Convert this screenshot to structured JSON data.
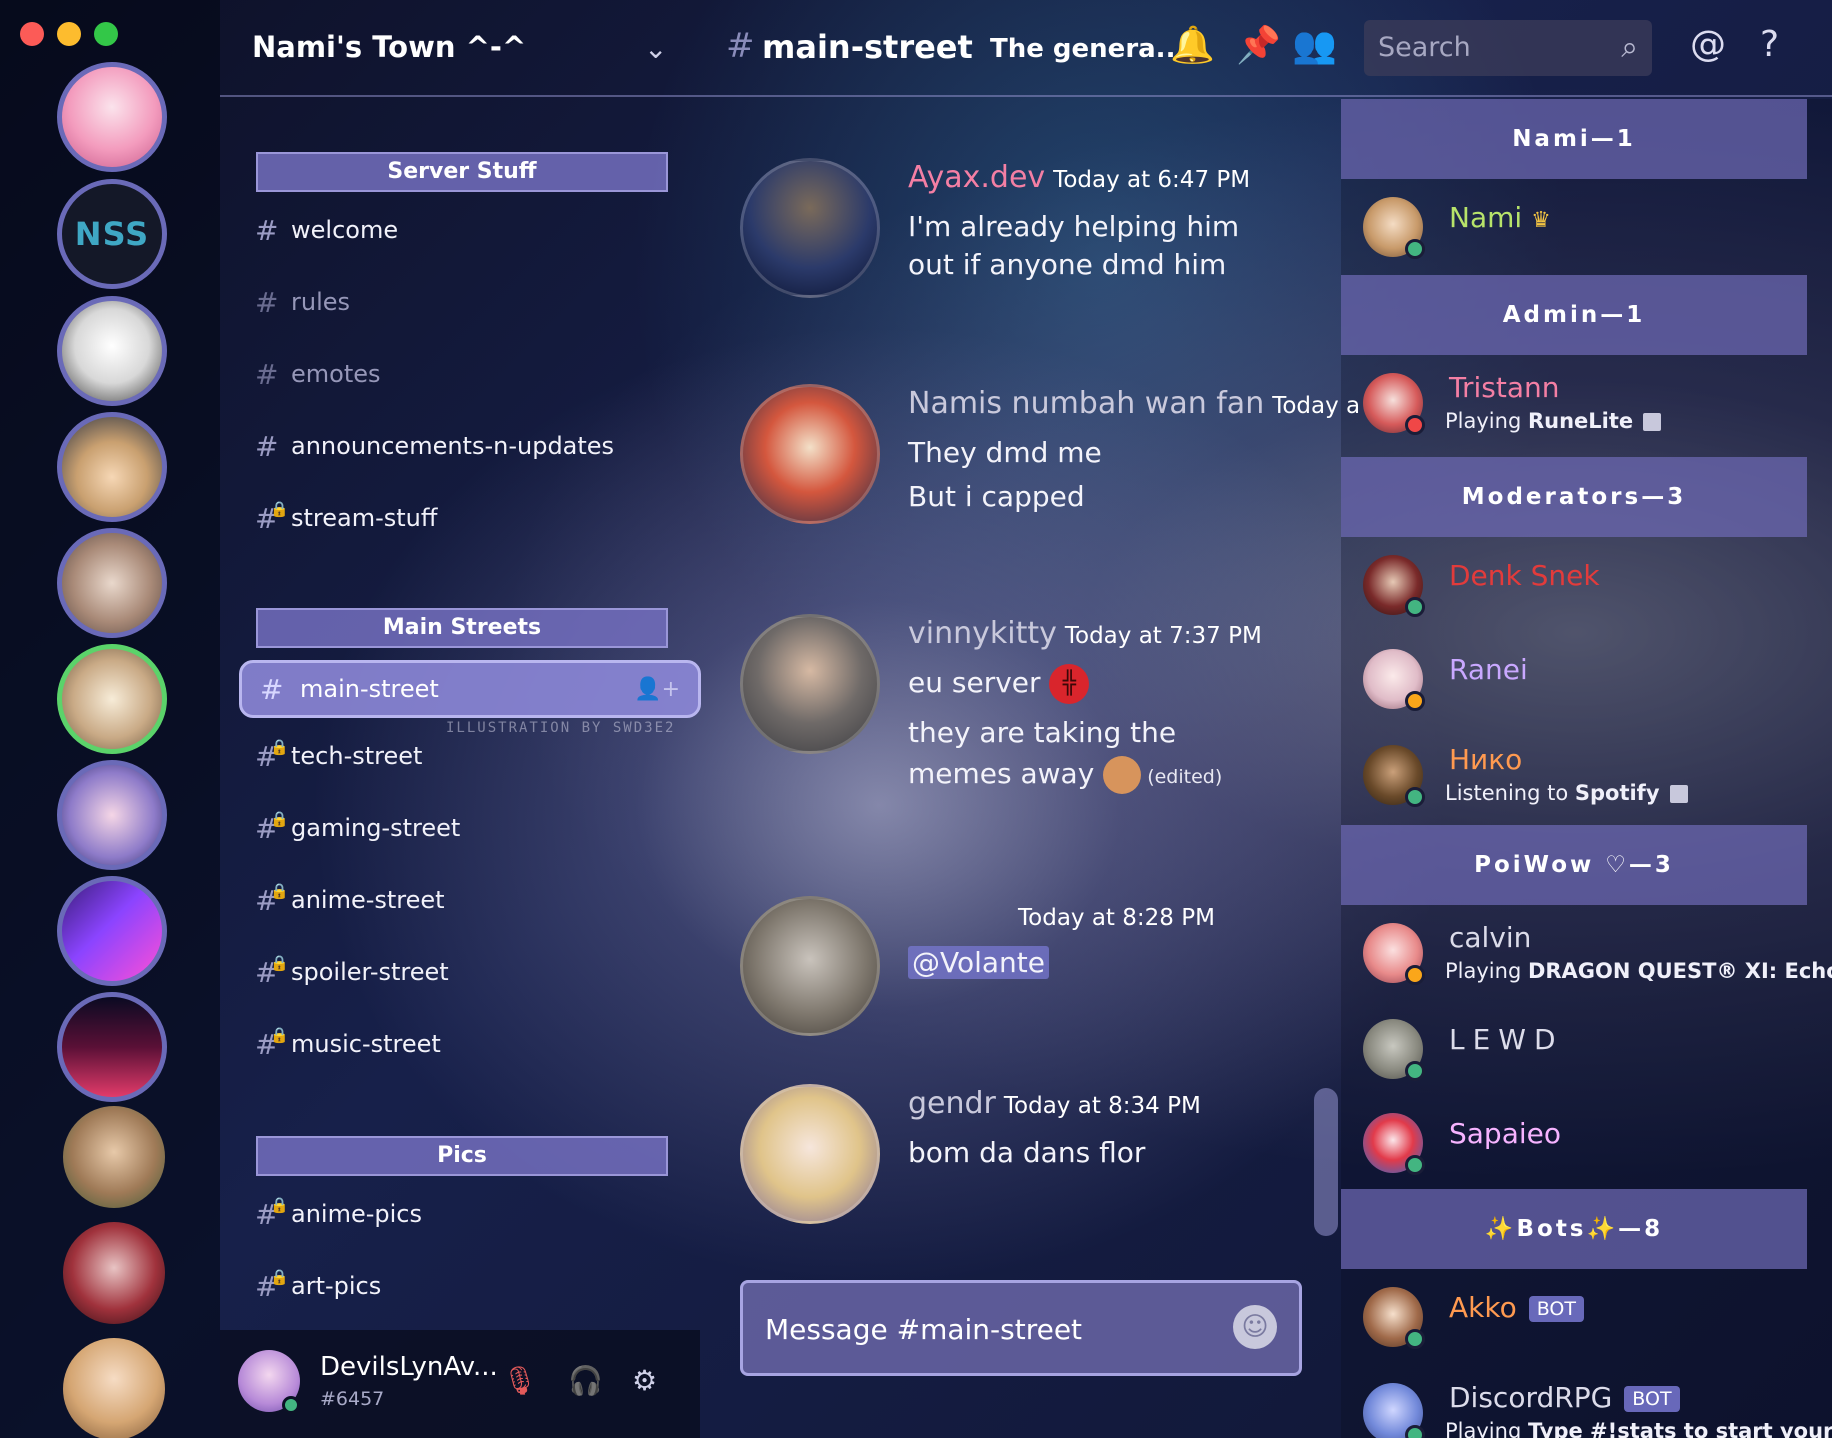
{
  "server": {
    "name": "Nami's Town ^-^"
  },
  "categories": [
    {
      "label": "Server Stuff"
    },
    {
      "label": "Main Streets"
    },
    {
      "label": "Pics"
    }
  ],
  "channels": {
    "server_stuff": [
      {
        "name": "welcome",
        "locked": false,
        "muted": false
      },
      {
        "name": "rules",
        "locked": false,
        "muted": true
      },
      {
        "name": "emotes",
        "locked": false,
        "muted": true
      },
      {
        "name": "announcements-n-updates",
        "locked": false,
        "muted": false
      },
      {
        "name": "stream-stuff",
        "locked": true,
        "muted": false
      }
    ],
    "main_streets": [
      {
        "name": "main-street",
        "active": true
      },
      {
        "name": "tech-street",
        "locked": true
      },
      {
        "name": "gaming-street",
        "locked": true
      },
      {
        "name": "anime-street",
        "locked": true
      },
      {
        "name": "spoiler-street",
        "locked": true
      },
      {
        "name": "music-street",
        "locked": true
      }
    ],
    "pics": [
      {
        "name": "anime-pics",
        "locked": true
      },
      {
        "name": "art-pics",
        "locked": true
      }
    ]
  },
  "background_credit": "ILLUSTRATION BY SWD3E2",
  "user": {
    "name": "DevilsLynAv...",
    "tag": "#6457",
    "status_color": "#43b581"
  },
  "chat": {
    "channel": "main-street",
    "topic": "The genera..",
    "search_placeholder": "Search",
    "composer_placeholder": "Message #main-street"
  },
  "messages": [
    {
      "author": "Ayax.dev",
      "color": "#f47fa4",
      "time": "Today at 6:47 PM",
      "lines": [
        "I'm already helping him",
        "out if anyone dmd him"
      ]
    },
    {
      "author": "Namis numbah wan fan",
      "color": "#c9c9dc",
      "time": "Today a",
      "lines": [
        "They dmd me",
        "But i capped"
      ]
    },
    {
      "author": "vinnykitty",
      "color": "#c9c9dc",
      "time": "Today at 7:37 PM",
      "lines": [
        "eu server",
        "they are taking the",
        "memes away"
      ],
      "edited": "(edited)"
    },
    {
      "author": "",
      "color": "#c9c9dc",
      "time": "Today at 8:28 PM",
      "lines": [
        "@Volante"
      ]
    },
    {
      "author": "gendr",
      "color": "#c9c9dc",
      "time": "Today at 8:34 PM",
      "lines": [
        "bom da dans flor"
      ]
    }
  ],
  "member_roles": [
    {
      "label": "Nami—1"
    },
    {
      "label": "Admin—1"
    },
    {
      "label": "Moderators—3"
    },
    {
      "label": "PoiWow ♡—3"
    },
    {
      "label": "✨Bots✨—8"
    }
  ],
  "members": [
    {
      "name": "Nami",
      "color": "#b7e36a",
      "status": "#43b581",
      "crown": true
    },
    {
      "name": "Tristann",
      "color": "#f47fa4",
      "status": "#f04747",
      "activity_prefix": "Playing ",
      "activity": "RuneLite"
    },
    {
      "name": "Denk Snek",
      "color": "#e23b3b",
      "status": "#43b581"
    },
    {
      "name": "Ranei",
      "color": "#c9a8ff",
      "status": "#faa61a"
    },
    {
      "name": "Нико",
      "color": "#ff9a50",
      "status": "#43b581",
      "activity_prefix": "Listening to ",
      "activity": "Spotify"
    },
    {
      "name": "calvin",
      "color": "#dcdcea",
      "status": "#faa61a",
      "activity_prefix": "Playing ",
      "activity": "DRAGON QUEST® XI: Echo..."
    },
    {
      "name": "LEWD",
      "color": "#dcdcea",
      "status": "#43b581"
    },
    {
      "name": "Sapaieo",
      "color": "#f6b3ff",
      "status": "#43b581"
    },
    {
      "name": "Akko",
      "color": "#ff9a50",
      "status": "#43b581",
      "badge": "BOT"
    },
    {
      "name": "DiscordRPG",
      "color": "#dcdcea",
      "status": "#43b581",
      "badge": "BOT",
      "activity_prefix": "Playing ",
      "activity": "Type #!stats to start your a..."
    }
  ],
  "colors": {
    "accent": "#7a76c8",
    "online": "#43b581",
    "idle": "#faa61a",
    "dnd": "#f04747"
  },
  "icons": [
    "bell-icon",
    "pin-icon",
    "members-icon",
    "search-icon",
    "mention-icon",
    "help-icon",
    "mic-muted-icon",
    "headphones-icon",
    "gear-icon",
    "add-member-icon",
    "emoji-icon",
    "chevron-down-icon"
  ]
}
